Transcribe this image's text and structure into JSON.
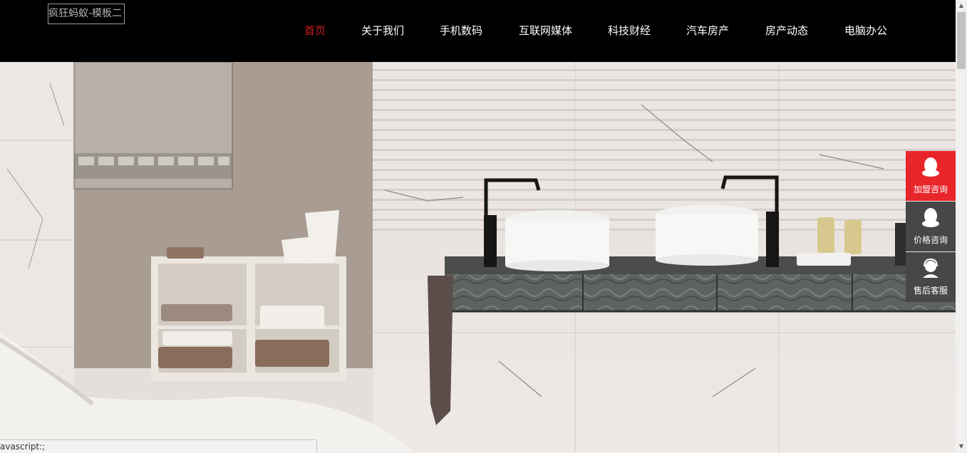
{
  "header": {
    "logo_text": "疯狂蚂蚁-模板二",
    "nav": [
      {
        "label": "首页",
        "active": true
      },
      {
        "label": "关于我们"
      },
      {
        "label": "手机数码"
      },
      {
        "label": "互联网媒体"
      },
      {
        "label": "科技财经"
      },
      {
        "label": "汽车房产"
      },
      {
        "label": "房产动态"
      },
      {
        "label": "电脑办公"
      }
    ]
  },
  "side_bar": [
    {
      "label": "加盟咨询",
      "icon": "qq-penguin-icon",
      "color": "#e8262a"
    },
    {
      "label": "价格咨询",
      "icon": "qq-penguin-icon",
      "color": "#474747"
    },
    {
      "label": "售后客服",
      "icon": "customer-service-icon",
      "color": "#474747"
    }
  ],
  "status_bar": {
    "text": "avascript:;"
  },
  "colors": {
    "header_bg": "#000000",
    "active_nav": "#d01f1f"
  }
}
